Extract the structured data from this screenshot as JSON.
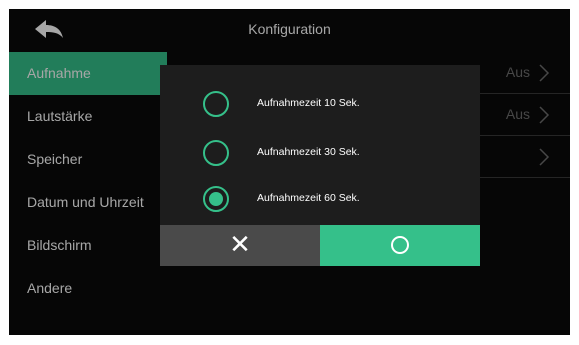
{
  "header": {
    "title": "Konfiguration",
    "back_icon": "back-arrow-icon"
  },
  "sidebar": {
    "items": [
      {
        "label": "Aufnahme",
        "active": true
      },
      {
        "label": "Lautstärke",
        "active": false
      },
      {
        "label": "Speicher",
        "active": false
      },
      {
        "label": "Datum und Uhrzeit",
        "active": false
      },
      {
        "label": "Bildschirm",
        "active": false
      },
      {
        "label": "Andere",
        "active": false
      }
    ]
  },
  "settings_rows": [
    {
      "value": "Aus",
      "icon": "chevron-right-icon"
    },
    {
      "value": "Aus",
      "icon": "chevron-right-icon"
    },
    {
      "value": "",
      "icon": "chevron-right-icon"
    }
  ],
  "dialog": {
    "options": [
      {
        "label": "Aufnahmezeit 10 Sek.",
        "selected": false
      },
      {
        "label": "Aufnahmezeit 30 Sek.",
        "selected": false
      },
      {
        "label": "Aufnahmezeit 60 Sek.",
        "selected": true
      }
    ],
    "cancel": {
      "glyph": "✕",
      "icon": "close-icon"
    },
    "confirm": {
      "icon": "circle-icon"
    }
  },
  "colors": {
    "accent": "#35c08a",
    "background": "#0a0a0a",
    "dialog": "#1d1d1d",
    "cancel_button": "#4a4a4a",
    "muted_text": "#6e6e6e"
  }
}
